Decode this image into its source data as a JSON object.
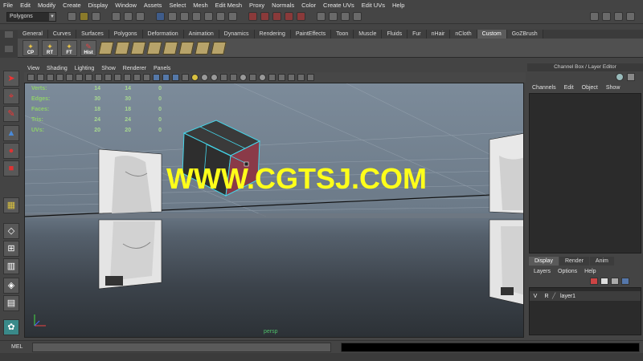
{
  "menubar": [
    "File",
    "Edit",
    "Modify",
    "Create",
    "Display",
    "Window",
    "Assets",
    "Select",
    "Mesh",
    "Edit Mesh",
    "Proxy",
    "Normals",
    "Color",
    "Create UVs",
    "Edit UVs",
    "Help"
  ],
  "statusline": {
    "mode": "Polygons"
  },
  "shelf": {
    "tabs": [
      "General",
      "Curves",
      "Surfaces",
      "Polygons",
      "Deformation",
      "Animation",
      "Dynamics",
      "Rendering",
      "PaintEffects",
      "Toon",
      "Muscle",
      "Fluids",
      "Fur",
      "nHair",
      "nCloth",
      "Custom",
      "GoZBrush"
    ],
    "active_tab": "Custom",
    "buttons": [
      "CP",
      "RT",
      "FT",
      "Hist"
    ]
  },
  "panel": {
    "menu": [
      "View",
      "Shading",
      "Lighting",
      "Show",
      "Renderer",
      "Panels"
    ],
    "camera": "persp"
  },
  "hud": [
    {
      "label": "Verts:",
      "a": "14",
      "b": "14",
      "c": "0"
    },
    {
      "label": "Edges:",
      "a": "30",
      "b": "30",
      "c": "0"
    },
    {
      "label": "Faces:",
      "a": "18",
      "b": "18",
      "c": "0"
    },
    {
      "label": "Tris:",
      "a": "24",
      "b": "24",
      "c": "0"
    },
    {
      "label": "UVs:",
      "a": "20",
      "b": "20",
      "c": "0"
    }
  ],
  "watermark": "WWW.CGTSJ.COM",
  "channelbox": {
    "title": "Channel Box / Layer Editor",
    "menu": [
      "Channels",
      "Edit",
      "Object",
      "Show"
    ]
  },
  "layers": {
    "tabs": [
      "Display",
      "Render",
      "Anim"
    ],
    "active_tab": "Display",
    "menu": [
      "Layers",
      "Options",
      "Help"
    ],
    "rows": [
      {
        "v": "V",
        "r": "R",
        "name": "layer1"
      }
    ]
  },
  "cmdline": {
    "label": "MEL"
  }
}
